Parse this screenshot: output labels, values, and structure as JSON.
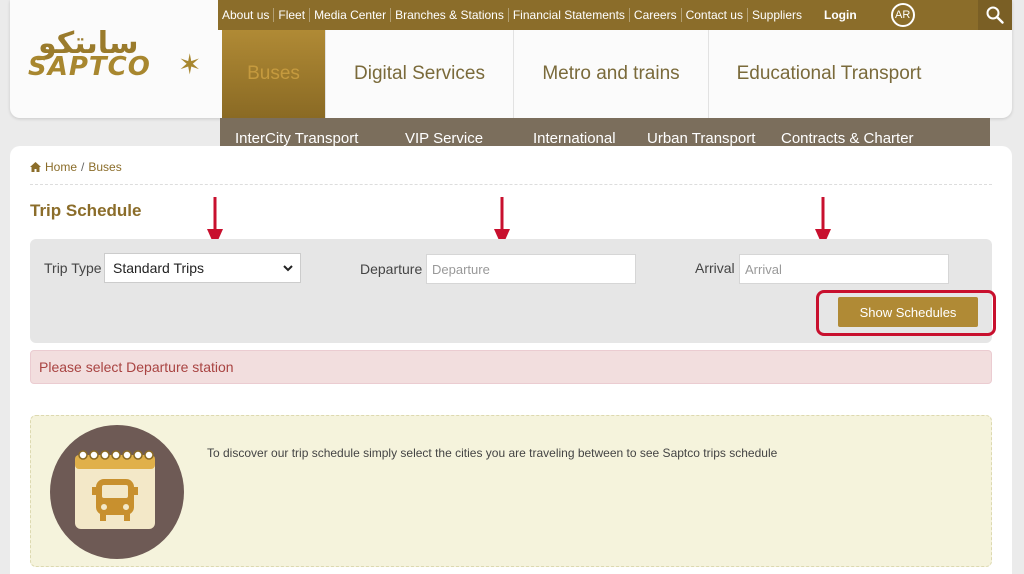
{
  "topbar": {
    "links": [
      "About us",
      "Fleet",
      "Media Center",
      "Branches & Stations",
      "Financial Statements",
      "Careers",
      "Contact us",
      "Suppliers"
    ],
    "login": "Login",
    "lang": "AR"
  },
  "logo": {
    "arabic": "سابتكو",
    "latin": "SAPTCO"
  },
  "main_nav": [
    "Buses",
    "Digital Services",
    "Metro and trains",
    "Educational Transport"
  ],
  "sub_nav": [
    "InterCity Transport",
    "VIP Service",
    "International",
    "Urban Transport",
    "Contracts & Charter"
  ],
  "breadcrumb": {
    "home": "Home",
    "separator": "/",
    "current": "Buses"
  },
  "page_title": "Trip Schedule",
  "form": {
    "trip_type_label": "Trip Type",
    "trip_type_value": "Standard Trips",
    "departure_label": "Departure",
    "departure_placeholder": "Departure",
    "arrival_label": "Arrival",
    "arrival_placeholder": "Arrival",
    "submit_label": "Show Schedules"
  },
  "alert": "Please select Departure station",
  "info": "To discover our trip schedule simply select the cities you are traveling between to see Saptco trips schedule",
  "colors": {
    "brand": "#8b6d2a",
    "accent": "#b08a35",
    "subnav": "#7b6e5c",
    "annotation": "#c8102e"
  }
}
